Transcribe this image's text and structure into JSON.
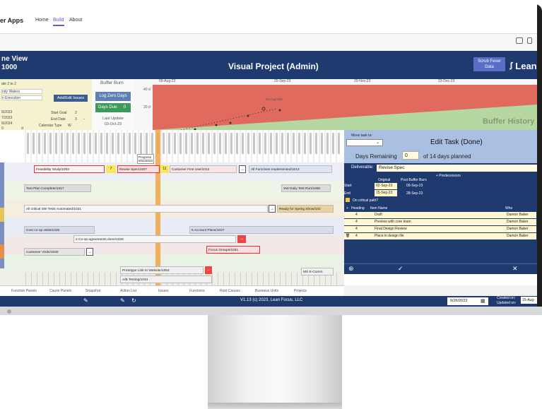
{
  "app": {
    "name": "er Apps",
    "nav": [
      "Home",
      "Build",
      "About"
    ],
    "active_nav": "Build"
  },
  "banner": {
    "left_line1": "ne View",
    "left_line2": "1000",
    "title": "Visual Project (Admin)",
    "scrub_fever": "Scrub Fever Data",
    "logo": "Lean"
  },
  "controls": {
    "gate": "ate 2 to 2",
    "team": "ndy Waters",
    "phase": "n Execution",
    "add_edit_button": "Add/Edit Issues",
    "date1": "9/2023",
    "date2": "7/2023",
    "date3": "9/2024",
    "start_goal": "Start Goal",
    "start_goal_val": "2",
    "end_date": "End Date",
    "end_date_val": "3",
    "calendar_type": "Calendar Type",
    "calendar_val": "W",
    "num1": "0",
    "num2": "d"
  },
  "buffer_burn": {
    "label": "Buffer Burn",
    "log_zero_days": "Log Zero Days",
    "days_due_label": "Days Due:",
    "days_due_value": "0",
    "last_update_label": "Last Update",
    "last_update_value": "03-Oct-23"
  },
  "buffer_history": {
    "dates": [
      "09-Aug-23",
      "25-Sep-23",
      "20-Nov-23",
      "23-Dec-23"
    ],
    "y_labels": [
      "40 d",
      "20 d"
    ],
    "point_label": "29-Aug-293",
    "watermark": "Buffer History"
  },
  "grid": {
    "progress_label": "Progress",
    "progress_date": "9/22/2023",
    "tasks": [
      {
        "label": "Feasibility Study/1003",
        "row": 0
      },
      {
        "label": "Revise Spec/1007",
        "row": 0
      },
      {
        "label": "Customer First Use/1012",
        "row": 0
      },
      {
        "label": "All Functions Implemented/1013",
        "row": 0
      },
      {
        "label": "Test Plan Complete/1017",
        "row": 1
      },
      {
        "label": "SW Daily Test Run/1008",
        "row": 1
      },
      {
        "label": "All critical SW Tests Automated/1021",
        "row": 2
      },
      {
        "label": "Ready for Spring Show/102",
        "row": 2
      },
      {
        "label": "Cost co-op visits/1025",
        "row": 3
      },
      {
        "label": "5 Account Plans/1027",
        "row": 3
      },
      {
        "label": "2 Co-op agreements done/1026",
        "row": 4
      },
      {
        "label": "Customer Visits/1030",
        "row": 5
      },
      {
        "label": "Focus Groups/1031",
        "row": 5
      },
      {
        "label": "Prototype Link to Website/1053",
        "row": 6
      },
      {
        "label": "MS E-Comm",
        "row": 6
      },
      {
        "label": "A/B Testing/1034",
        "row": 7
      }
    ],
    "badges": [
      "7",
      "11"
    ]
  },
  "edit_task": {
    "move_task_to": "Move task to:",
    "title": "Edit Task (Done)",
    "days_remaining_label": "Days Remaining",
    "days_remaining_value": "0",
    "days_planned": "of 14 days planned",
    "deliverable_label": "Deliverable:",
    "deliverable_value": "Revise Spec",
    "predecessors": "+ Predecessors",
    "original_label": "Original",
    "post_buffer_label": "Post Buffer Burn",
    "start_label": "Start",
    "end_label": "End",
    "start_original": "02-Sep-23",
    "end_original": "15-Sep-23",
    "start_post": "09-Sep-23",
    "end_post": "28-Sep-23",
    "critical_path": "On critical path?",
    "columns": [
      "Heading",
      "Item Name",
      "Who"
    ],
    "rows": [
      {
        "heading": "4",
        "item": "Draft",
        "who": "Damon Baker"
      },
      {
        "heading": "4",
        "item": "Preview with core team",
        "who": "Damon Baker"
      },
      {
        "heading": "4",
        "item": "Final Design Review",
        "who": "Damon Baker"
      },
      {
        "heading": "4",
        "item": "Place in design file",
        "who": "Damon Baker"
      }
    ]
  },
  "tabs": [
    "Function Panels",
    "Cause Panels",
    "Snapshot",
    "Action List",
    "Issues",
    "Functions",
    "Root Causes",
    "Business Units",
    "Projects"
  ],
  "footer": {
    "copyright": "V1.13 (c) 2023, Lean Focus, LLC",
    "date": "9/26/2023",
    "created_on": "Created on:",
    "updated_on": "Updated on:",
    "created_value": "15-Aug-"
  },
  "colors": {
    "navy": "#1f3a6e",
    "red_zone": "#e06a5e",
    "green_zone": "#b5d7a0",
    "accent": "#5b5fc7"
  }
}
